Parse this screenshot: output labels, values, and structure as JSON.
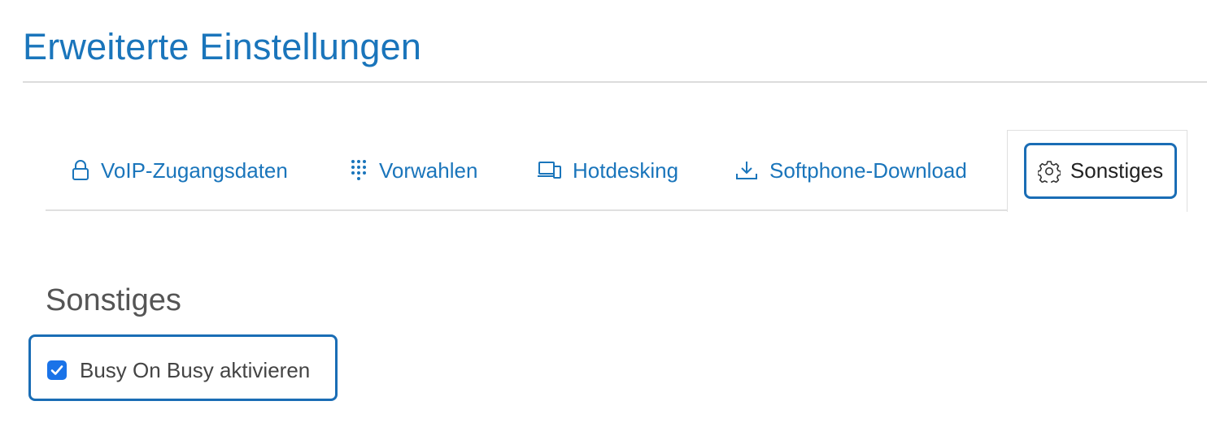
{
  "page": {
    "title": "Erweiterte Einstellungen"
  },
  "tabs": [
    {
      "label": "VoIP-Zugangsdaten",
      "icon": "lock-icon"
    },
    {
      "label": "Vorwahlen",
      "icon": "dialpad-icon"
    },
    {
      "label": "Hotdesking",
      "icon": "devices-icon"
    },
    {
      "label": "Softphone-Download",
      "icon": "download-icon"
    },
    {
      "label": "Sonstiges",
      "icon": "gear-icon",
      "active": true
    }
  ],
  "section": {
    "heading": "Sonstiges",
    "checkbox": {
      "label": "Busy On Busy aktivieren",
      "checked": true
    }
  },
  "colors": {
    "accent": "#1a75bb",
    "focus_border": "#1a6db5",
    "checkbox": "#1a73e8"
  }
}
